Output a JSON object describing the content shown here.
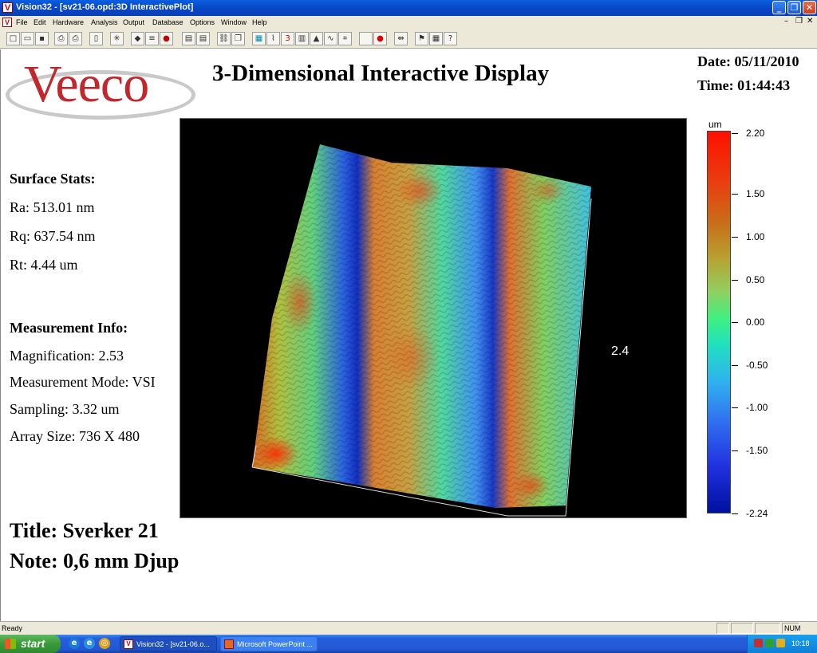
{
  "window": {
    "title": "Vision32 - [sv21-06.opd:3D InteractivePlot]",
    "app_icon": "V"
  },
  "menu": [
    "File",
    "Edit",
    "Hardware",
    "Analysis",
    "Output",
    "Database",
    "Options",
    "Window",
    "Help"
  ],
  "toolbar_icons": [
    "new-icon",
    "open-icon",
    "save-icon",
    "print-preview-icon",
    "print-icon",
    "page-icon",
    "sparkle-icon",
    "analysis-icon",
    "compare-icon",
    "stats-icon",
    "frame-icon",
    "frame2-icon",
    "link-icon",
    "copy-icon",
    "color-map-icon",
    "profile-icon",
    "3d-icon",
    "histogram-icon",
    "peak-icon",
    "curve-icon",
    "crop-icon",
    "blank-icon",
    "record-icon",
    "align-icon",
    "filter-icon",
    "report-icon",
    "help-icon"
  ],
  "logo": {
    "text": "Veeco"
  },
  "heading": "3-Dimensional Interactive Display",
  "date": "Date: 05/11/2010",
  "time": "Time: 01:44:43",
  "surface_stats": {
    "header": "Surface Stats:",
    "ra": "Ra: 513.01 nm",
    "rq": "Rq: 637.54 nm",
    "rt": "Rt: 4.44 um"
  },
  "measurement_info": {
    "header": "Measurement Info:",
    "magnification": "Magnification: 2.53",
    "mode": "Measurement Mode: VSI",
    "sampling": "Sampling: 3.32 um",
    "array_size": "Array Size: 736 X 480"
  },
  "title_line": "Title: Sverker 21",
  "note_line": "Note: 0,6 mm Djup",
  "plot": {
    "axis_label": "2.4"
  },
  "colorbar": {
    "unit": "um",
    "labels": [
      "2.20",
      "1.50",
      "1.00",
      "0.50",
      "0.00",
      "-0.50",
      "-1.00",
      "-1.50",
      "-2.24"
    ],
    "colors": {
      "top": "#ff1000",
      "mid": "#40f080",
      "bottom": "#0010a0"
    }
  },
  "status": {
    "text": "Ready",
    "num": "NUM"
  },
  "taskbar": {
    "start": "start",
    "tasks": [
      "Vision32 - [sv21-06.o...",
      "Microsoft PowerPoint ..."
    ],
    "clock": "10:18"
  }
}
